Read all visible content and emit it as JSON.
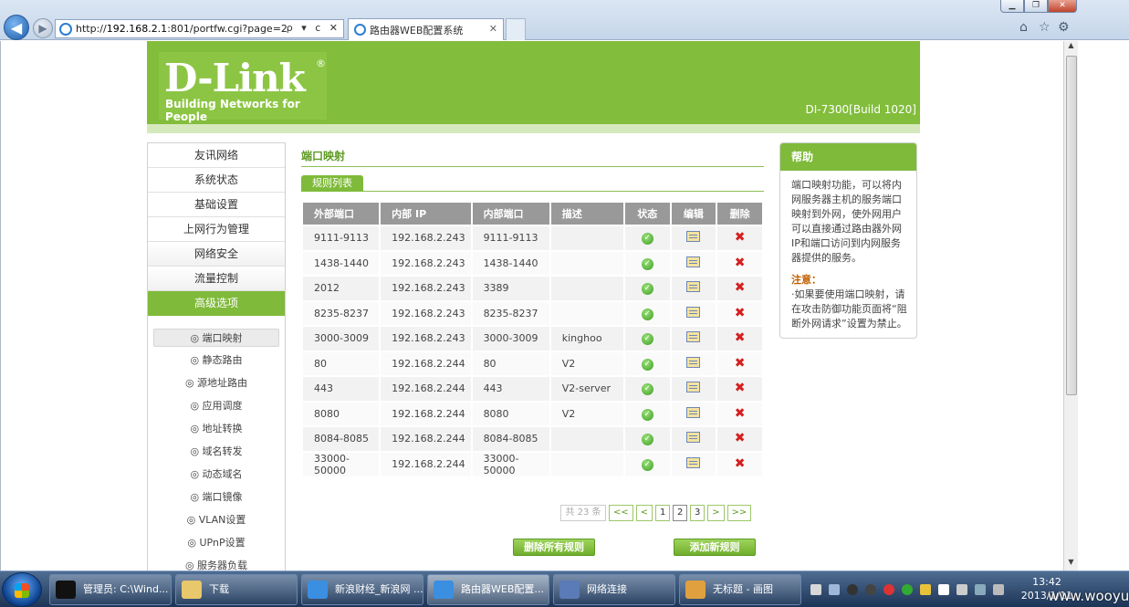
{
  "browser": {
    "url_prefix": "http://",
    "url_host": "192.168.2.1",
    "url_rest": ":801/portfw.cgi?page=2",
    "url_tools": "ρ ▾ ᴄ ✕",
    "tab_title": "路由器WEB配置系统",
    "tab_close": "✕",
    "back": "◀",
    "forward": "▶",
    "min": "▁",
    "max": "❐",
    "close": "✕",
    "home_icon": "⌂",
    "fav_icon": "☆",
    "tools_icon": "⚙"
  },
  "header": {
    "logo": "D-Link",
    "logo_reg": "®",
    "tagline": "Building Networks for People",
    "model": "DI-7300[Build 1020]"
  },
  "menu": {
    "items": [
      "友讯网络",
      "系统状态",
      "基础设置",
      "上网行为管理",
      "网络安全",
      "流量控制",
      "高级选项"
    ],
    "sub_items": [
      "◎ 端口映射",
      "◎ 静态路由",
      "◎ 源地址路由",
      "◎ 应用调度",
      "◎ 地址转换",
      "◎ 域名转发",
      "◎ 动态域名",
      "◎ 端口镜像",
      "◎ VLAN设置",
      "◎ UPnP设置",
      "◎ 服务器负载"
    ]
  },
  "main": {
    "title": "端口映射",
    "tab": "规则列表",
    "columns": [
      "外部端口",
      "内部  IP",
      "内部端口",
      "描述",
      "状态",
      "编辑",
      "删除"
    ],
    "rows": [
      {
        "ext": "9111-9113",
        "ip": "192.168.2.243",
        "int": "9111-9113",
        "desc": ""
      },
      {
        "ext": "1438-1440",
        "ip": "192.168.2.243",
        "int": "1438-1440",
        "desc": ""
      },
      {
        "ext": "2012",
        "ip": "192.168.2.243",
        "int": "3389",
        "desc": ""
      },
      {
        "ext": "8235-8237",
        "ip": "192.168.2.243",
        "int": "8235-8237",
        "desc": ""
      },
      {
        "ext": "3000-3009",
        "ip": "192.168.2.243",
        "int": "3000-3009",
        "desc": "kinghoo"
      },
      {
        "ext": "80",
        "ip": "192.168.2.244",
        "int": "80",
        "desc": "V2"
      },
      {
        "ext": "443",
        "ip": "192.168.2.244",
        "int": "443",
        "desc": "V2-server"
      },
      {
        "ext": "8080",
        "ip": "192.168.2.244",
        "int": "8080",
        "desc": "V2"
      },
      {
        "ext": "8084-8085",
        "ip": "192.168.2.244",
        "int": "8084-8085",
        "desc": ""
      },
      {
        "ext": "33000-50000",
        "ip": "192.168.2.244",
        "int": "33000-50000",
        "desc": ""
      }
    ],
    "status_glyph": "✓",
    "delete_glyph": "✖",
    "pager": {
      "total": "共  23 条",
      "first": "<<",
      "prev": "<",
      "pages": [
        "1",
        "2",
        "3"
      ],
      "current": "2",
      "next": ">",
      "last": ">>"
    },
    "delete_all": "删除所有规则",
    "add_rule": "添加新规则"
  },
  "help": {
    "title": "帮助",
    "body": "端口映射功能，可以将内网服务器主机的服务端口映射到外网，使外网用户可以直接通过路由器外网IP和端口访问到内网服务器提供的服务。",
    "note_title": "注意：",
    "note_body": "·如果要使用端口映射，请在攻击防御功能页面将“阻断外网请求”设置为禁止。"
  },
  "taskbar": {
    "tasks": [
      "管理员: C:\\Wind...",
      "下载",
      "新浪财经_新浪网 ...",
      "路由器WEB配置...",
      "网络连接",
      "无标题 - 画图"
    ],
    "time": "13:42",
    "date": "2013/1/11",
    "watermark": "www.wooyun.org"
  },
  "colors": {
    "brand_green": "#82bd3c",
    "header_stripe": "#d6e9bd",
    "delete_red": "#d61f1f"
  }
}
